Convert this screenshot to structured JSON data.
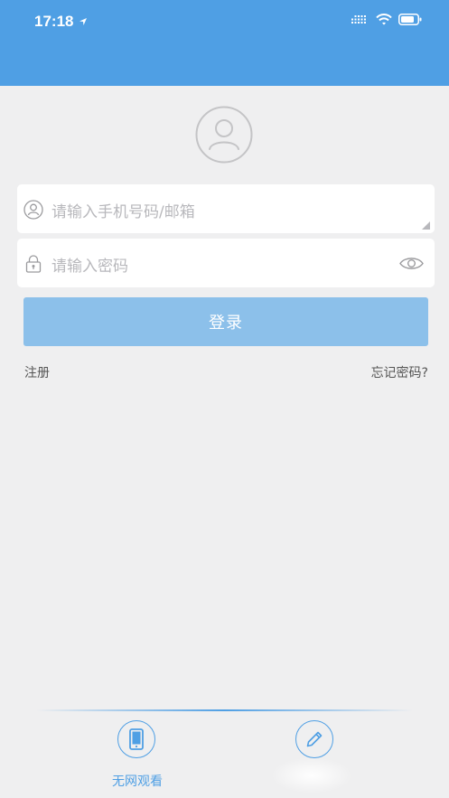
{
  "status_bar": {
    "time": "17:18"
  },
  "login": {
    "account_placeholder": "请输入手机号码/邮箱",
    "password_placeholder": "请输入密码",
    "login_button": "登录",
    "register_link": "注册",
    "forgot_link": "忘记密码?"
  },
  "bottom_tabs": [
    {
      "label": "无网观看",
      "icon": "phone-icon"
    },
    {
      "label": "",
      "icon": "pencil-icon"
    }
  ],
  "colors": {
    "header": "#4f9fe4",
    "login_button": "#8cc0ea",
    "background": "#efeff0",
    "accent": "#4f9fe4"
  }
}
